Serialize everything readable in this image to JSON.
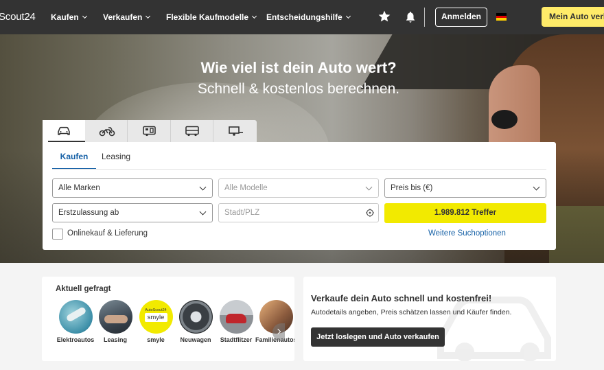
{
  "header": {
    "logo": "Scout24",
    "nav": [
      {
        "label": "Kaufen"
      },
      {
        "label": "Verkaufen"
      },
      {
        "label": "Flexible Kaufmodelle"
      },
      {
        "label": "Entscheidungshilfe"
      }
    ],
    "icons": [
      "star-icon",
      "bell-icon",
      "flag-de-icon"
    ],
    "login_label": "Anmelden",
    "sell_label": "Mein Auto verkaufen"
  },
  "hero": {
    "title": "Wie viel ist dein Auto wert?",
    "subtitle": "Schnell & kostenlos berechnen."
  },
  "search": {
    "vehicle_tabs": [
      "car-icon",
      "motorcycle-icon",
      "caravan-icon",
      "transporter-icon",
      "trailer-icon"
    ],
    "tabs": [
      {
        "label": "Kaufen",
        "active": true
      },
      {
        "label": "Leasing",
        "active": false
      }
    ],
    "make_select": "Alle Marken",
    "model_select": "Alle Modelle",
    "price_select": "Preis bis (€)",
    "registration_select": "Erstzulassung ab",
    "location_placeholder": "Stadt/PLZ",
    "results_button": "1.989.812 Treffer",
    "online_purchase_label": "Onlinekauf & Lieferung",
    "more_options_link": "Weitere Suchoptionen"
  },
  "trending": {
    "title": "Aktuell gefragt",
    "items": [
      {
        "label": "Elektroautos"
      },
      {
        "label": "Leasing"
      },
      {
        "label": "smyle",
        "badge_top": "AutoScout24",
        "badge_main": "smyle"
      },
      {
        "label": "Neuwagen"
      },
      {
        "label": "Stadtflitzer"
      },
      {
        "label": "Familienautos"
      }
    ]
  },
  "sell_card": {
    "title": "Verkaufe dein Auto schnell und kostenfrei!",
    "description": "Autodetails angeben, Preis schätzen lassen und Käufer finden.",
    "cta": "Jetzt loslegen und Auto verkaufen"
  },
  "colors": {
    "header_bg": "#333333",
    "accent_yellow": "#f2ea00",
    "sell_button_yellow": "#ffeb69",
    "link_blue": "#1560a6"
  }
}
